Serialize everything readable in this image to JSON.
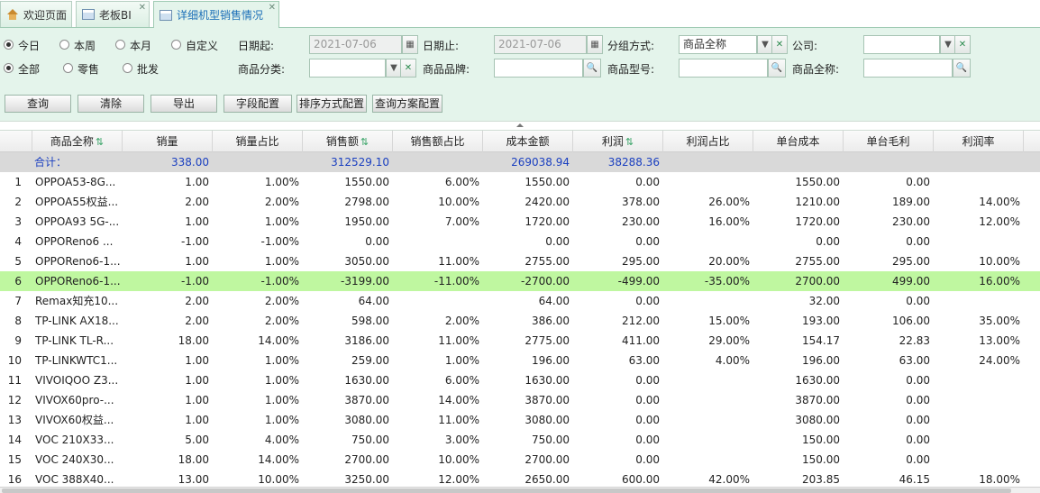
{
  "tabs": [
    {
      "label": "欢迎页面",
      "icon": "home-icon"
    },
    {
      "label": "老板BI",
      "icon": "table-icon"
    },
    {
      "label": "详细机型销售情况",
      "icon": "table-icon"
    }
  ],
  "filters": {
    "range_options": [
      "今日",
      "本周",
      "本月",
      "自定义"
    ],
    "range_selected": "今日",
    "type_options": [
      "全部",
      "零售",
      "批发"
    ],
    "type_selected": "全部",
    "date_from_label": "日期起:",
    "date_from_value": "2021-07-06",
    "date_to_label": "日期止:",
    "date_to_value": "2021-07-06",
    "group_label": "分组方式:",
    "group_value": "商品全称",
    "company_label": "公司:",
    "company_value": "",
    "category_label": "商品分类:",
    "category_value": "",
    "brand_label": "商品品牌:",
    "brand_value": "",
    "model_label": "商品型号:",
    "model_value": "",
    "fullname_label": "商品全称:",
    "fullname_value": ""
  },
  "actions": {
    "query": "查询",
    "clear": "清除",
    "export": "导出",
    "field_config": "字段配置",
    "sort_config": "排序方式配置",
    "query_scheme_config": "查询方案配置"
  },
  "table": {
    "columns": [
      "商品全称",
      "销量",
      "销量占比",
      "销售额",
      "销售额占比",
      "成本金额",
      "利润",
      "利润占比",
      "单台成本",
      "单台毛利",
      "利润率"
    ],
    "total": {
      "label": "合计：",
      "qty": "338.00",
      "sales": "312529.10",
      "cost": "269038.94",
      "profit": "38288.36"
    },
    "rows": [
      [
        "1",
        "OPPOA53-8G...",
        "1.00",
        "1.00%",
        "1550.00",
        "6.00%",
        "1550.00",
        "0.00",
        "",
        "1550.00",
        "0.00",
        ""
      ],
      [
        "2",
        "OPPOA55权益...",
        "2.00",
        "2.00%",
        "2798.00",
        "10.00%",
        "2420.00",
        "378.00",
        "26.00%",
        "1210.00",
        "189.00",
        "14.00%"
      ],
      [
        "3",
        "OPPOA93 5G-...",
        "1.00",
        "1.00%",
        "1950.00",
        "7.00%",
        "1720.00",
        "230.00",
        "16.00%",
        "1720.00",
        "230.00",
        "12.00%"
      ],
      [
        "4",
        "OPPOReno6 ...",
        "-1.00",
        "-1.00%",
        "0.00",
        "",
        "0.00",
        "0.00",
        "",
        "0.00",
        "0.00",
        ""
      ],
      [
        "5",
        "OPPOReno6-1...",
        "1.00",
        "1.00%",
        "3050.00",
        "11.00%",
        "2755.00",
        "295.00",
        "20.00%",
        "2755.00",
        "295.00",
        "10.00%"
      ],
      [
        "6",
        "OPPOReno6-1...",
        "-1.00",
        "-1.00%",
        "-3199.00",
        "-11.00%",
        "-2700.00",
        "-499.00",
        "-35.00%",
        "2700.00",
        "499.00",
        "16.00%"
      ],
      [
        "7",
        "Remax知充10...",
        "2.00",
        "2.00%",
        "64.00",
        "",
        "64.00",
        "0.00",
        "",
        "32.00",
        "0.00",
        ""
      ],
      [
        "8",
        "TP-LINK AX18...",
        "2.00",
        "2.00%",
        "598.00",
        "2.00%",
        "386.00",
        "212.00",
        "15.00%",
        "193.00",
        "106.00",
        "35.00%"
      ],
      [
        "9",
        "TP-LINK TL-R...",
        "18.00",
        "14.00%",
        "3186.00",
        "11.00%",
        "2775.00",
        "411.00",
        "29.00%",
        "154.17",
        "22.83",
        "13.00%"
      ],
      [
        "10",
        "TP-LINKWTC1...",
        "1.00",
        "1.00%",
        "259.00",
        "1.00%",
        "196.00",
        "63.00",
        "4.00%",
        "196.00",
        "63.00",
        "24.00%"
      ],
      [
        "11",
        "VIVOIQOO Z3...",
        "1.00",
        "1.00%",
        "1630.00",
        "6.00%",
        "1630.00",
        "0.00",
        "",
        "1630.00",
        "0.00",
        ""
      ],
      [
        "12",
        "VIVOX60pro-...",
        "1.00",
        "1.00%",
        "3870.00",
        "14.00%",
        "3870.00",
        "0.00",
        "",
        "3870.00",
        "0.00",
        ""
      ],
      [
        "13",
        "VIVOX60权益...",
        "1.00",
        "1.00%",
        "3080.00",
        "11.00%",
        "3080.00",
        "0.00",
        "",
        "3080.00",
        "0.00",
        ""
      ],
      [
        "14",
        "VOC 210X33...",
        "5.00",
        "4.00%",
        "750.00",
        "3.00%",
        "750.00",
        "0.00",
        "",
        "150.00",
        "0.00",
        ""
      ],
      [
        "15",
        "VOC 240X30...",
        "18.00",
        "14.00%",
        "2700.00",
        "10.00%",
        "2700.00",
        "0.00",
        "",
        "150.00",
        "0.00",
        ""
      ],
      [
        "16",
        "VOC 388X40...",
        "13.00",
        "10.00%",
        "3250.00",
        "12.00%",
        "2650.00",
        "600.00",
        "42.00%",
        "203.85",
        "46.15",
        "18.00%"
      ]
    ],
    "highlight_row": "6",
    "highlight_color": "#bff7a0"
  },
  "colors": {
    "panel_bg": "#e4f4eb",
    "total_text": "#1a3fc0",
    "sort_icon": "#3aa468"
  }
}
